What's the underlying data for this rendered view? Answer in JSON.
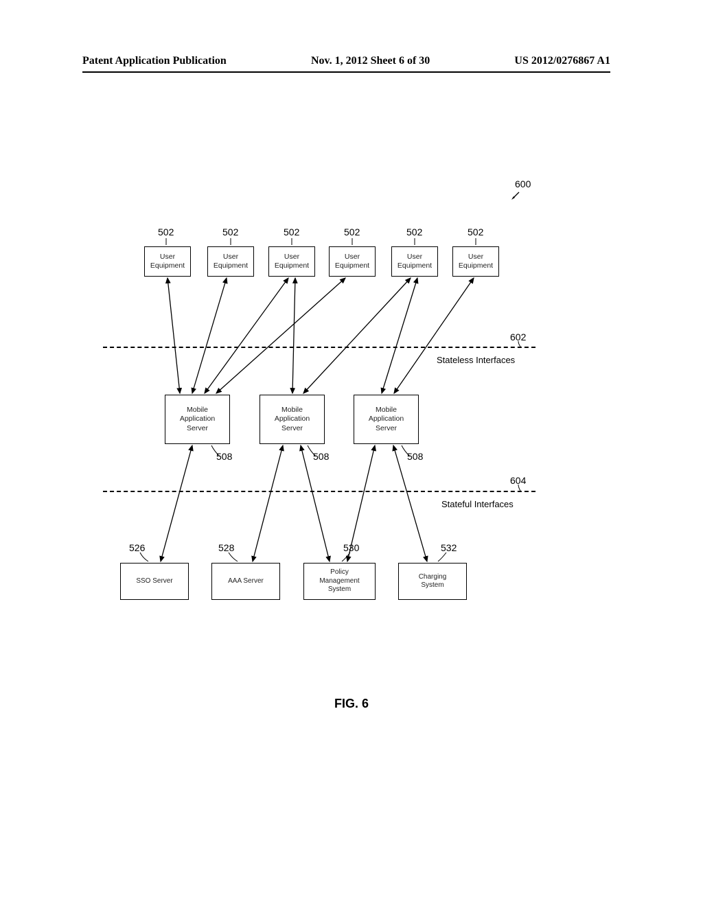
{
  "header": {
    "left": "Patent Application Publication",
    "center": "Nov. 1, 2012  Sheet 6 of 30",
    "right": "US 2012/0276867 A1"
  },
  "figure_caption": "FIG. 6",
  "refs": {
    "fig": "600",
    "ue": "502",
    "mas": "508",
    "stateless": "602",
    "stateful": "604",
    "sso": "526",
    "aaa": "528",
    "policy": "530",
    "charging": "532"
  },
  "boxes": {
    "ue": "User\nEquipment",
    "mas": "Mobile\nApplication\nServer",
    "sso": "SSO Server",
    "aaa": "AAA Server",
    "policy": "Policy\nManagement\nSystem",
    "charging": "Charging\nSystem"
  },
  "labels": {
    "stateless": "Stateless Interfaces",
    "stateful": "Stateful Interfaces"
  },
  "chart_data": {
    "type": "diagram",
    "title": "FIG. 6",
    "nodes": [
      {
        "id": "ue1",
        "label": "User Equipment",
        "ref": "502"
      },
      {
        "id": "ue2",
        "label": "User Equipment",
        "ref": "502"
      },
      {
        "id": "ue3",
        "label": "User Equipment",
        "ref": "502"
      },
      {
        "id": "ue4",
        "label": "User Equipment",
        "ref": "502"
      },
      {
        "id": "ue5",
        "label": "User Equipment",
        "ref": "502"
      },
      {
        "id": "ue6",
        "label": "User Equipment",
        "ref": "502"
      },
      {
        "id": "mas1",
        "label": "Mobile Application Server",
        "ref": "508"
      },
      {
        "id": "mas2",
        "label": "Mobile Application Server",
        "ref": "508"
      },
      {
        "id": "mas3",
        "label": "Mobile Application Server",
        "ref": "508"
      },
      {
        "id": "sso",
        "label": "SSO Server",
        "ref": "526"
      },
      {
        "id": "aaa",
        "label": "AAA Server",
        "ref": "528"
      },
      {
        "id": "policy",
        "label": "Policy Management System",
        "ref": "530"
      },
      {
        "id": "charging",
        "label": "Charging System",
        "ref": "532"
      }
    ],
    "edges_stateless": [
      [
        "ue1",
        "mas1"
      ],
      [
        "ue2",
        "mas1"
      ],
      [
        "ue3",
        "mas1"
      ],
      [
        "ue3",
        "mas2"
      ],
      [
        "ue4",
        "mas2"
      ],
      [
        "ue4",
        "mas1"
      ],
      [
        "ue5",
        "mas2"
      ],
      [
        "ue5",
        "mas3"
      ],
      [
        "ue6",
        "mas3"
      ]
    ],
    "edges_stateful": [
      [
        "mas1",
        "sso"
      ],
      [
        "mas2",
        "aaa"
      ],
      [
        "mas2",
        "policy"
      ],
      [
        "mas3",
        "policy"
      ],
      [
        "mas3",
        "charging"
      ]
    ],
    "regions": [
      {
        "label": "Stateless Interfaces",
        "ref": "602",
        "between": [
          "ue",
          "mas"
        ]
      },
      {
        "label": "Stateful Interfaces",
        "ref": "604",
        "between": [
          "mas",
          "bottom"
        ]
      }
    ],
    "figure_ref": "600"
  }
}
